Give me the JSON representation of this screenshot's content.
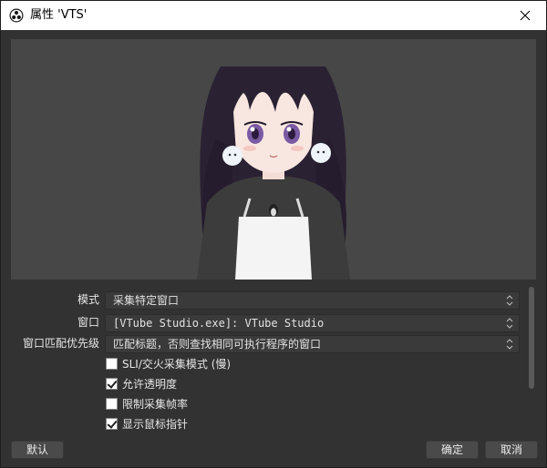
{
  "window": {
    "title": "属性 'VTS'",
    "close_icon": "close-icon",
    "app_icon": "obs-logo-icon"
  },
  "properties": {
    "mode": {
      "label": "模式",
      "value": "采集特定窗口"
    },
    "window": {
      "label": "窗口",
      "value": "[VTube Studio.exe]: VTube Studio"
    },
    "priority": {
      "label": "窗口匹配优先级",
      "value": "匹配标题，否则查找相同可执行程序的窗口"
    }
  },
  "checkboxes": [
    {
      "label": "SLI/交火采集模式 (慢)",
      "checked": false
    },
    {
      "label": "允许透明度",
      "checked": true
    },
    {
      "label": "限制采集帧率",
      "checked": false
    },
    {
      "label": "显示鼠标指针",
      "checked": true
    }
  ],
  "buttons": {
    "defaults": "默认",
    "ok": "确定",
    "cancel": "取消"
  },
  "colors": {
    "background": "#323232",
    "preview_bg": "#474747",
    "titlebar": "#ffffff"
  }
}
